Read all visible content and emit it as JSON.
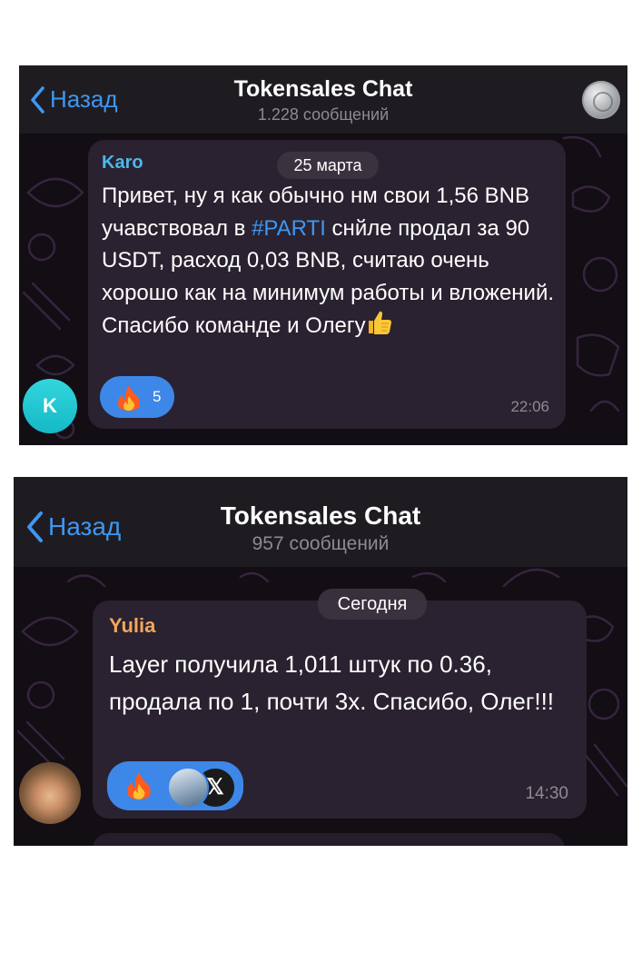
{
  "panels": [
    {
      "header": {
        "back_label": "Назад",
        "title": "Tokensales Chat",
        "subtitle": "1.228 сообщений"
      },
      "date_label": "25 марта",
      "message": {
        "sender": "Karo",
        "text_before_tag": "Привет, ну я как обычно нм свои 1,56 BNB учавствовал в ",
        "hashtag": "#PARTI",
        "text_after_tag": " снйле продал за 90 USDT, расход 0,03 BNB, считаю очень хорошо как на минимум работы и вложений. Спасибо команде и Олегу",
        "reaction_count": "5",
        "time": "22:06",
        "avatar_initial": "K"
      }
    },
    {
      "header": {
        "back_label": "Назад",
        "title": "Tokensales Chat",
        "subtitle": "957 сообщений"
      },
      "date_label": "Сегодня",
      "message": {
        "sender": "Yulia",
        "text": "Layer получила 1,011 штук по 0.36, продала по 1, почти 3х. Спасибо, Олег!!!",
        "time": "14:30"
      }
    }
  ],
  "colors": {
    "link_blue": "#3e97f2",
    "chat_bg": "#120e14",
    "bubble_bg": "#2a2230",
    "reaction_bg": "#3d87e8",
    "sender_karo": "#4fb7e8",
    "sender_yulia": "#f2a65a"
  },
  "icons": [
    "chevron-left-icon",
    "fire-icon",
    "thumbs-up-icon",
    "x-logo-icon"
  ]
}
